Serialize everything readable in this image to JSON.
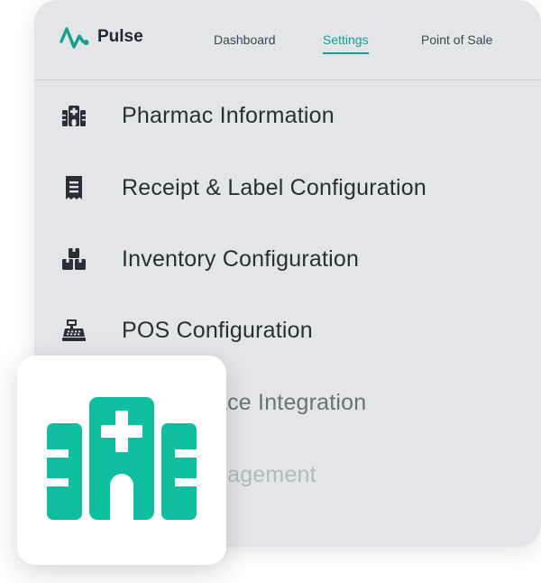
{
  "app": {
    "name": "Pulse",
    "logo_icon": "pulse-waveform-icon",
    "brand_color": "#13a08e"
  },
  "nav": {
    "dashboard": "Dashboard",
    "settings": "Settings",
    "point_of_sale": "Point of Sale",
    "active": "Settings"
  },
  "menu": {
    "items": [
      {
        "label": "Pharmac Information",
        "icon": "hospital-building-icon"
      },
      {
        "label": "Receipt & Label Configuration",
        "icon": "receipt-icon"
      },
      {
        "label": "Inventory Configuration",
        "icon": "boxes-icon"
      },
      {
        "label": "POS Configuration",
        "icon": "cash-register-icon"
      },
      {
        "label": "ace Integration",
        "icon": ""
      },
      {
        "label": "nagement",
        "icon": ""
      }
    ]
  },
  "featured_tile": {
    "icon": "hospital-building-icon",
    "color": "#0fbe9f"
  }
}
